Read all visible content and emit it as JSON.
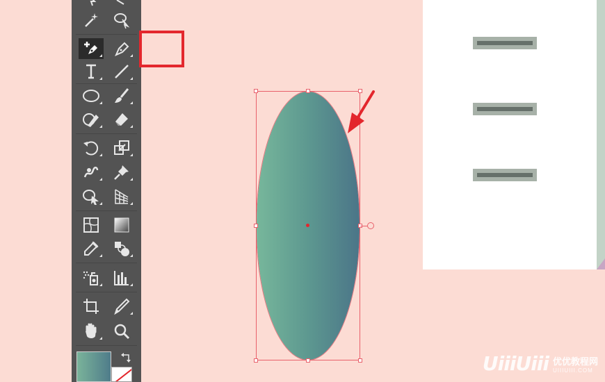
{
  "toolbar": {
    "tools": [
      {
        "name": "magic-wand-tool",
        "icon": "magic-wand-icon"
      },
      {
        "name": "lasso-tool",
        "icon": "lasso-icon"
      },
      {
        "name": "curvature-tool",
        "icon": "curvature-icon",
        "active": true
      },
      {
        "name": "pen-tool",
        "icon": "pen-icon"
      },
      {
        "name": "type-tool",
        "icon": "type-icon"
      },
      {
        "name": "line-tool",
        "icon": "line-icon"
      },
      {
        "name": "ellipse-tool",
        "icon": "ellipse-icon"
      },
      {
        "name": "paintbrush-tool",
        "icon": "paintbrush-icon"
      },
      {
        "name": "shaper-tool",
        "icon": "shaper-icon"
      },
      {
        "name": "eraser-tool",
        "icon": "eraser-icon"
      },
      {
        "name": "rotate-tool",
        "icon": "rotate-icon"
      },
      {
        "name": "scale-tool",
        "icon": "scale-icon"
      },
      {
        "name": "warp-tool",
        "icon": "warp-icon"
      },
      {
        "name": "puppet-warp-tool",
        "icon": "pushpin-icon"
      },
      {
        "name": "shape-builder-tool",
        "icon": "shape-builder-icon"
      },
      {
        "name": "perspective-grid-tool",
        "icon": "perspective-grid-icon"
      },
      {
        "name": "mesh-tool",
        "icon": "mesh-icon"
      },
      {
        "name": "gradient-tool",
        "icon": "gradient-icon"
      },
      {
        "name": "eyedropper-tool",
        "icon": "eyedropper-icon"
      },
      {
        "name": "blend-tool",
        "icon": "blend-icon"
      },
      {
        "name": "symbol-sprayer-tool",
        "icon": "symbol-sprayer-icon"
      },
      {
        "name": "column-graph-tool",
        "icon": "column-graph-icon"
      },
      {
        "name": "artboard-tool",
        "icon": "artboard-icon"
      },
      {
        "name": "slice-tool",
        "icon": "slice-icon"
      },
      {
        "name": "hand-tool",
        "icon": "hand-icon"
      },
      {
        "name": "zoom-tool",
        "icon": "zoom-icon"
      }
    ],
    "fill_gradient": [
      "#7ab39a",
      "#4f7c8a"
    ],
    "stroke_color": "#e3272d"
  },
  "canvas": {
    "background": "#fcdcd4",
    "ellipse_gradient": [
      "#77b79b",
      "#5d9890",
      "#4b7588"
    ],
    "selection_color": "#e85f6a",
    "annotation_arrow_color": "#e3272d"
  },
  "preview": {
    "background": "#ffffff",
    "dash_count": 3
  },
  "watermark": {
    "logo": "UiiiUiii",
    "text_cn": "优优教程网",
    "url": "UIIIUIII.COM"
  }
}
